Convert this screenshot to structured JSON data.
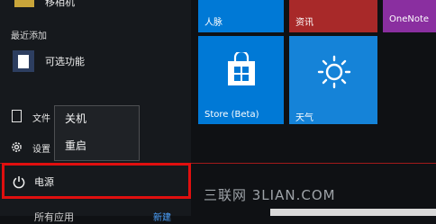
{
  "start_menu": {
    "top_item_label": "移相机",
    "recently_added_label": "最近添加",
    "recent_app_label": "可选功能",
    "documents_label": "文件",
    "settings_label": "设置",
    "power_label": "电源",
    "all_apps_label": "所有应用",
    "new_badge": "新建"
  },
  "power_menu": {
    "shutdown_label": "关机",
    "restart_label": "重启"
  },
  "tiles": {
    "people_label": "人脉",
    "news_label": "资讯",
    "onenote_label": "OneNote",
    "store_label": "Store (Beta)",
    "weather_label": "天气"
  },
  "watermark": {
    "text": "三联网 3LIAN.COM"
  },
  "colors": {
    "highlight_red": "#e00f0f",
    "tile_blue": "#0079d6",
    "tile_red": "#a82929",
    "tile_purple": "#8a2fa0"
  }
}
